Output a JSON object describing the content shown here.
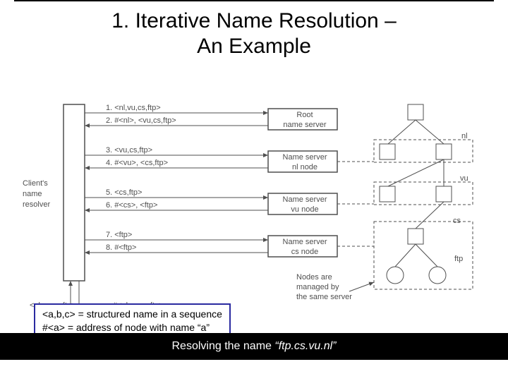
{
  "title_line1": "1. Iterative Name Resolution –",
  "title_line2": "An Example",
  "client_label_1": "Client's",
  "client_label_2": "name",
  "client_label_3": "resolver",
  "root_server_1": "Root",
  "root_server_2": "name server",
  "ns_nl_1": "Name server",
  "ns_nl_2": "nl node",
  "ns_vu_1": "Name server",
  "ns_vu_2": "vu node",
  "ns_cs_1": "Name server",
  "ns_cs_2": "cs node",
  "step1": "1. <nl,vu,cs,ftp>",
  "step2": "2. #<nl>, <vu,cs,ftp>",
  "step3": "3. <vu,cs,ftp>",
  "step4": "4. #<vu>, <cs,ftp>",
  "step5": "5. <cs,ftp>",
  "step6": "6. #<cs>, <ftp>",
  "step7": "7. <ftp>",
  "step8": "8. #<ftp>",
  "input_left": "<nl,vu,cs,ftp>",
  "output_mid": "#<nl,vu,cs,ftp>",
  "right_nl": "nl",
  "right_vu": "vu",
  "right_cs": "cs",
  "right_ftp": "ftp",
  "nodes_note_1": "Nodes are",
  "nodes_note_2": "managed by",
  "nodes_note_3": "the same server",
  "legend_line1": "<a,b,c> = structured name in a sequence",
  "legend_line2": "#<a> = address of node with name “a”",
  "footer_prefix": "Resolving the name ",
  "footer_quote": "“ftp.cs.vu.nl”"
}
